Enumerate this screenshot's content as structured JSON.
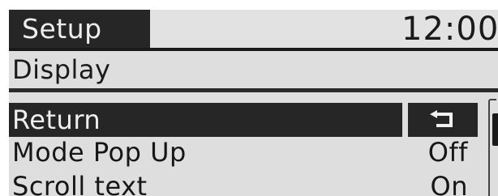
{
  "header": {
    "title": "Setup",
    "clock": "12:00"
  },
  "section": {
    "title": "Display"
  },
  "menu": {
    "items": [
      {
        "label": "Return",
        "value": "",
        "icon": "return-arrow-icon",
        "selected": true
      },
      {
        "label": "Mode Pop Up",
        "value": "Off",
        "selected": false
      },
      {
        "label": "Scroll text",
        "value": "On",
        "selected": false
      }
    ]
  },
  "colors": {
    "screen_bg": "#dedede",
    "highlight_bg": "#262626",
    "highlight_text": "#efefef",
    "text": "#161616"
  }
}
